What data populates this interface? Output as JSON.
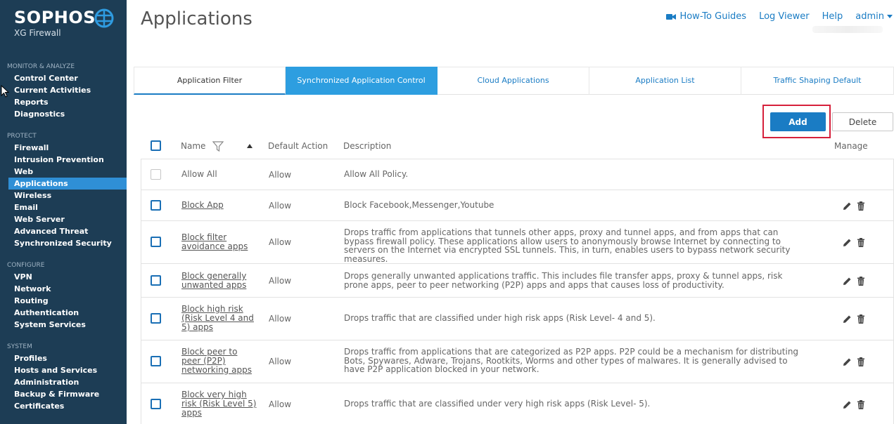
{
  "app": {
    "logo": "SOPHOS",
    "product": "XG Firewall"
  },
  "sidebar": {
    "sections": [
      {
        "heading": "MONITOR & ANALYZE",
        "items": [
          "Control Center",
          "Current Activities",
          "Reports",
          "Diagnostics"
        ]
      },
      {
        "heading": "PROTECT",
        "items": [
          "Firewall",
          "Intrusion Prevention",
          "Web",
          "Applications",
          "Wireless",
          "Email",
          "Web Server",
          "Advanced Threat",
          "Synchronized Security"
        ]
      },
      {
        "heading": "CONFIGURE",
        "items": [
          "VPN",
          "Network",
          "Routing",
          "Authentication",
          "System Services"
        ]
      },
      {
        "heading": "SYSTEM",
        "items": [
          "Profiles",
          "Hosts and Services",
          "Administration",
          "Backup & Firmware",
          "Certificates"
        ]
      }
    ],
    "active_item": "Applications"
  },
  "header": {
    "title": "Applications",
    "links": {
      "howto": "How-To Guides",
      "log_viewer": "Log Viewer",
      "help": "Help",
      "admin": "admin"
    }
  },
  "tabs": [
    {
      "label": "Application Filter"
    },
    {
      "label": "Synchronized Application Control"
    },
    {
      "label": "Cloud Applications"
    },
    {
      "label": "Application List"
    },
    {
      "label": "Traffic Shaping Default"
    }
  ],
  "toolbar": {
    "add_label": "Add",
    "delete_label": "Delete"
  },
  "table": {
    "columns": {
      "name": "Name",
      "default_action": "Default Action",
      "description": "Description",
      "manage": "Manage"
    },
    "rows": [
      {
        "name": "Allow All",
        "action": "Allow",
        "description": "Allow All Policy."
      },
      {
        "name": "Block App",
        "action": "Allow",
        "description": "Block Facebook,Messenger,Youtube"
      },
      {
        "name": "Block filter avoidance apps",
        "action": "Allow",
        "description": "Drops traffic from applications that tunnels other apps, proxy and tunnel apps, and from apps that can bypass firewall policy. These applications allow users to anonymously browse Internet by connecting to servers on the Internet via encrypted SSL tunnels. This, in turn, enables users to bypass network security measures."
      },
      {
        "name": "Block generally unwanted apps",
        "action": "Allow",
        "description": "Drops generally unwanted applications traffic. This includes file transfer apps, proxy & tunnel apps, risk prone apps, peer to peer networking (P2P) apps and apps that causes loss of productivity."
      },
      {
        "name": "Block high risk (Risk Level 4 and 5) apps",
        "action": "Allow",
        "description": "Drops traffic that are classified under high risk apps (Risk Level- 4 and 5)."
      },
      {
        "name": "Block peer to peer (P2P) networking apps",
        "action": "Allow",
        "description": "Drops traffic from applications that are categorized as P2P apps. P2P could be a mechanism for distributing Bots, Spywares, Adware, Trojans, Rootkits, Worms and other types of malwares. It is generally advised to have P2P application blocked in your network."
      },
      {
        "name": "Block very high risk (Risk Level 5) apps",
        "action": "Allow",
        "description": "Drops traffic that are classified under very high risk apps (Risk Level- 5)."
      }
    ]
  },
  "colors": {
    "sidebar_bg": "#1d3d55",
    "accent": "#1a7cc4",
    "active_tab": "#2d9ee0",
    "highlight": "#d6203b"
  }
}
